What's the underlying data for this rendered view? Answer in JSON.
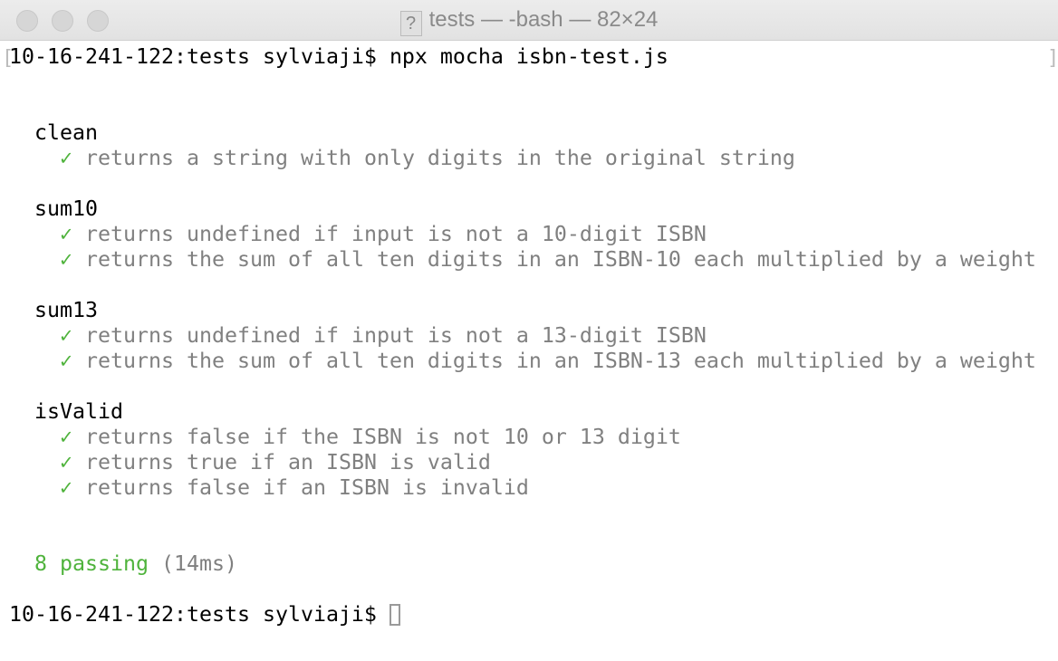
{
  "window": {
    "title": "tests — -bash — 82×24",
    "title_icon": "question-mark-document-icon"
  },
  "terminal": {
    "prompt": "10-16-241-122:tests sylviaji$",
    "command": "npx mocha isbn-test.js",
    "suites": [
      {
        "name": "clean",
        "tests": [
          "returns a string with only digits in the original string"
        ]
      },
      {
        "name": "sum10",
        "tests": [
          "returns undefined if input is not a 10-digit ISBN",
          "returns the sum of all ten digits in an ISBN-10 each multiplied by a weight"
        ]
      },
      {
        "name": "sum13",
        "tests": [
          "returns undefined if input is not a 13-digit ISBN",
          "returns the sum of all ten digits in an ISBN-13 each multiplied by a weight"
        ]
      },
      {
        "name": "isValid",
        "tests": [
          "returns false if the ISBN is not 10 or 13 digit",
          "returns true if an ISBN is valid",
          "returns false if an ISBN is invalid"
        ]
      }
    ],
    "check_mark": "✓",
    "summary": {
      "passing": "8 passing",
      "duration": "(14ms)"
    },
    "colors": {
      "pass": "#4fb33c",
      "dim": "#808080"
    }
  }
}
